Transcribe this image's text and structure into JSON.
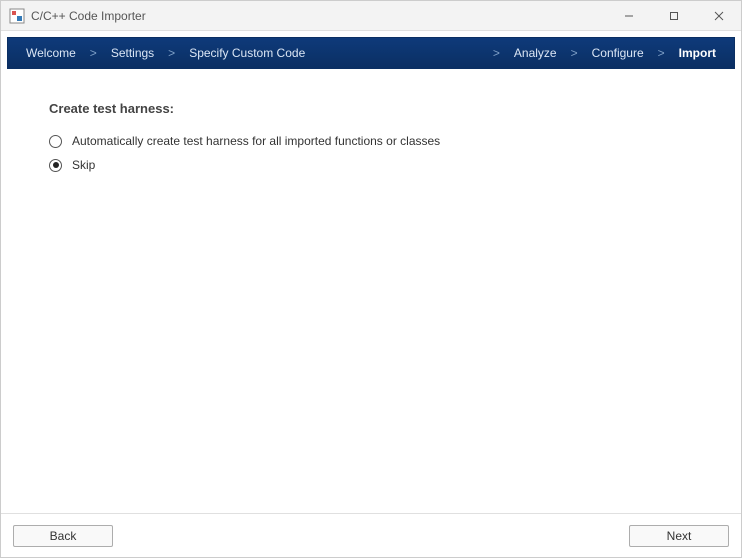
{
  "window": {
    "title": "C/C++ Code Importer"
  },
  "steps": {
    "welcome": "Welcome",
    "settings": "Settings",
    "specify": "Specify Custom Code",
    "analyze": "Analyze",
    "configure": "Configure",
    "import": "Import"
  },
  "main": {
    "heading": "Create test harness:",
    "options": {
      "auto": "Automatically create test harness for all imported functions or classes",
      "skip": "Skip"
    },
    "selected": "skip"
  },
  "footer": {
    "back": "Back",
    "next": "Next"
  }
}
